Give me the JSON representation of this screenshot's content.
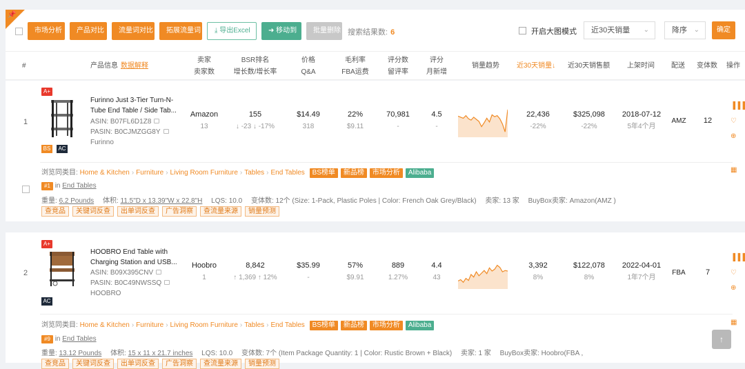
{
  "toolbar": {
    "buttons": [
      "市场分析",
      "产品对比",
      "流量词对比",
      "拓展流量词",
      "导出Excel",
      "移动到",
      "批量删除"
    ],
    "search_label": "搜索结果数:",
    "search_count": "6",
    "bigimg_label": "开启大图模式",
    "period_select": "近30天销量",
    "order_select": "降序",
    "confirm_label": "确定"
  },
  "header": {
    "index": "#",
    "product": "产品信息",
    "product_link": "数据解释",
    "seller": [
      "卖家",
      "卖家数"
    ],
    "bsr": [
      "BSR排名",
      "增长数/增长率"
    ],
    "price": [
      "价格",
      "Q&A"
    ],
    "margin": [
      "毛利率",
      "FBA运费"
    ],
    "reviews": [
      "评分数",
      "留评率"
    ],
    "rating": [
      "评分",
      "月新增"
    ],
    "trend": "销量趋势",
    "sales30": "近30天销量↓",
    "revenue30": "近30天销售额",
    "listed": "上架时间",
    "delivery": "配送",
    "variants": "变体数",
    "actions": "操作"
  },
  "products": [
    {
      "index": "1",
      "aplus": "A+",
      "title_line1": "Furinno Just 3-Tier Turn-N-",
      "title_line2": "Tube End Table / Side Tab...",
      "asin": "ASIN: B07FL6D1Z8",
      "pasin": "PASIN: B0CJMZGG8Y",
      "brand": "Furinno",
      "tags": [
        "BS",
        "AC"
      ],
      "seller": "Amazon",
      "seller_count": "13",
      "bsr": "155",
      "bsr_change": "-23",
      "bsr_rate": "-17%",
      "price": "$14.49",
      "qa": "318",
      "margin": "22%",
      "fba": "$9.11",
      "reviews": "70,981",
      "review_rate": "-",
      "rating": "4.5",
      "rating_new": "-",
      "sales": "22,436",
      "sales_change": "-22%",
      "revenue": "$325,098",
      "revenue_change": "-22%",
      "listed": "2018-07-12",
      "listed_age": "5年4个月",
      "delivery": "AMZ",
      "variants": "12",
      "category_label": "浏览同类目:",
      "categories": [
        "Home & Kitchen",
        "Furniture",
        "Living Room Furniture",
        "Tables",
        "End Tables"
      ],
      "cat_tags": [
        "BS榜单",
        "新品榜",
        "市场分析",
        "Alibaba"
      ],
      "rank_badge": "#1",
      "rank_in": "in",
      "rank_cat": "End Tables",
      "weight_label": "重量:",
      "weight": "6.2 Pounds",
      "volume_label": "体积:",
      "volume": "11.5\"D x 13.39\"W x 22.8\"H",
      "lqs": "LQS: 10.0",
      "variant_info": "变体数: 12个 (Size: 1-Pack, Plastic Poles | Color: French Oak Grey/Black)",
      "sellers_info": "卖家: 13 家",
      "buybox": "BuyBox卖家: Amazon(AMZ )",
      "tools": [
        "查竞品",
        "关键词反查",
        "出单词反查",
        "广告洞察",
        "查流量来源",
        "销量预测"
      ]
    },
    {
      "index": "2",
      "aplus": "A+",
      "title_line1": "HOOBRO End Table with",
      "title_line2": "Charging Station and USB...",
      "asin": "ASIN: B09X395CNV",
      "pasin": "PASIN: B0C49NWSSQ",
      "brand": "HOOBRO",
      "tags": [
        "AC"
      ],
      "seller": "Hoobro",
      "seller_count": "1",
      "bsr": "8,842",
      "bsr_change": "1,369",
      "bsr_rate": "12%",
      "price": "$35.99",
      "qa": "-",
      "margin": "57%",
      "fba": "$9.91",
      "reviews": "889",
      "review_rate": "1.27%",
      "rating": "4.4",
      "rating_new": "43",
      "sales": "3,392",
      "sales_change": "8%",
      "revenue": "$122,078",
      "revenue_change": "8%",
      "listed": "2022-04-01",
      "listed_age": "1年7个月",
      "delivery": "FBA",
      "variants": "7",
      "category_label": "浏览同类目:",
      "categories": [
        "Home & Kitchen",
        "Furniture",
        "Living Room Furniture",
        "Tables",
        "End Tables"
      ],
      "cat_tags": [
        "BS榜单",
        "新品榜",
        "市场分析",
        "Alibaba"
      ],
      "rank_badge": "#9",
      "rank_in": "in",
      "rank_cat": "End Tables",
      "weight_label": "重量:",
      "weight": "13.12 Pounds",
      "volume_label": "体积:",
      "volume": "15 x 11 x 21.7 inches",
      "lqs": "LQS: 10.0",
      "variant_info": "变体数: 7个 (Item Package Quantity: 1 | Color: Rustic Brown + Black)",
      "sellers_info": "卖家: 1 家",
      "buybox": "BuyBox卖家: Hoobro(FBA ,",
      "tools": [
        "查竞品",
        "关键词反查",
        "出单词反查",
        "广告洞察",
        "查流量来源",
        "销量预测"
      ]
    }
  ],
  "trend_data": {
    "row1": [
      0.7,
      0.66,
      0.62,
      0.72,
      0.6,
      0.55,
      0.66,
      0.58,
      0.5,
      0.3,
      0.45,
      0.62,
      0.48,
      0.75,
      0.68,
      0.72,
      0.6,
      0.4,
      0.1,
      0.95
    ],
    "row2": [
      0.2,
      0.25,
      0.15,
      0.3,
      0.22,
      0.45,
      0.35,
      0.55,
      0.4,
      0.5,
      0.6,
      0.48,
      0.7,
      0.58,
      0.65,
      0.8,
      0.72,
      0.55,
      0.6,
      0.58
    ]
  },
  "scroll_top_label": "↑",
  "colors": {
    "accent": "#f08a24",
    "green": "#4cae8f",
    "red": "#e8392c"
  }
}
